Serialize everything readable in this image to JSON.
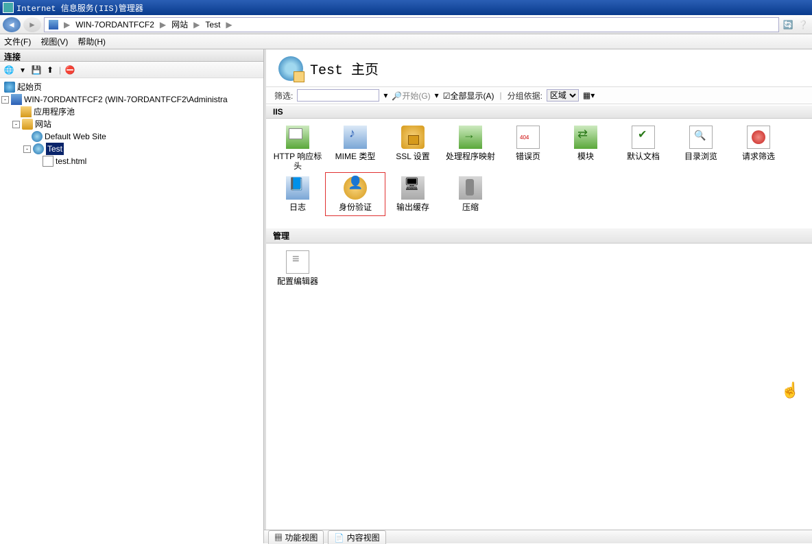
{
  "window": {
    "title": "Internet 信息服务(IIS)管理器"
  },
  "breadcrumb": {
    "server": "WIN-7ORDANTFCF2",
    "sites": "网站",
    "site": "Test"
  },
  "menu": {
    "file": "文件(F)",
    "view": "视图(V)",
    "help": "帮助(H)"
  },
  "sidebar": {
    "header": "连接",
    "tree": {
      "start": "起始页",
      "server": "WIN-7ORDANTFCF2 (WIN-7ORDANTFCF2\\Administra",
      "apppool": "应用程序池",
      "sites": "网站",
      "default_site": "Default Web Site",
      "test_site": "Test",
      "test_file": "test.html"
    }
  },
  "content": {
    "title": "Test 主页",
    "filter_label": "筛选:",
    "go_label": "开始(G)",
    "showall_label": "全部显示(A)",
    "groupby_label": "分组依据:",
    "groupby_value": "区域",
    "groups": {
      "iis": "IIS",
      "mgmt": "管理"
    },
    "items_iis": [
      "HTTP 响应标头",
      "MIME 类型",
      "SSL 设置",
      "处理程序映射",
      "错误页",
      "模块",
      "默认文档",
      "目录浏览",
      "请求筛选",
      "日志",
      "身份验证",
      "输出缓存",
      "压缩"
    ],
    "items_mgmt": [
      "配置编辑器"
    ]
  },
  "status": {
    "func_view": "功能视图",
    "content_view": "内容视图"
  }
}
